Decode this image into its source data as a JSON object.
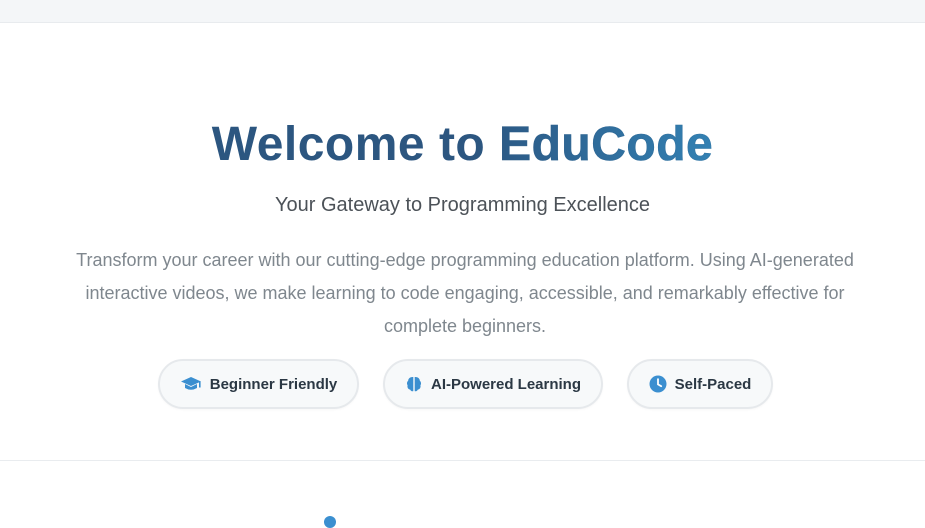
{
  "hero": {
    "title_part1": "Welcome to ",
    "title_part2": "EduCode",
    "subtitle": "Your Gateway to Programming Excellence",
    "description": "Transform your career with our cutting-edge programming education platform. Using AI-generated interactive videos, we make learning to code engaging, accessible, and remarkably effective for complete beginners."
  },
  "features": [
    {
      "label": "Beginner Friendly",
      "icon": "graduation-cap-icon"
    },
    {
      "label": "AI-Powered Learning",
      "icon": "brain-icon"
    },
    {
      "label": "Self-Paced",
      "icon": "clock-icon"
    }
  ],
  "colors": {
    "title": "#2c5680",
    "accent": "#3b8fd0",
    "badge_bg": "#f7f9fa",
    "badge_border": "#e6e9ec"
  }
}
